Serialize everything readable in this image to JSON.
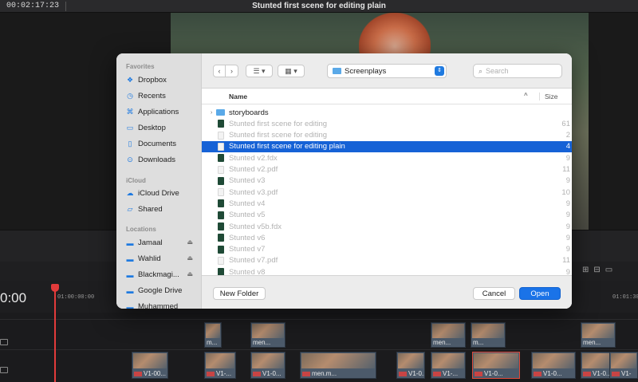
{
  "editor": {
    "timecode": "00:02:17:23",
    "project_title": "Stunted first scene for editing plain",
    "playhead_timecode": "0:00",
    "ruler_left": "01:00:00:00",
    "ruler_right": "01:01:30"
  },
  "timeline_clips": {
    "v2": [
      "m...",
      "men...",
      "men...",
      "m...",
      "men..."
    ],
    "v1": [
      "V1-00...",
      "V1-...",
      "V1-0...",
      "men.m...",
      "V1-0...",
      "V1-...",
      "V1-0...",
      "V1-0...",
      "V1-0...",
      "V1-"
    ]
  },
  "dialog": {
    "sidebar": {
      "favorites_heading": "Favorites",
      "favorites": [
        {
          "label": "Dropbox",
          "icon": "dropbox-icon"
        },
        {
          "label": "Recents",
          "icon": "clock-icon"
        },
        {
          "label": "Applications",
          "icon": "applications-icon"
        },
        {
          "label": "Desktop",
          "icon": "desktop-icon"
        },
        {
          "label": "Documents",
          "icon": "document-icon"
        },
        {
          "label": "Downloads",
          "icon": "download-icon"
        }
      ],
      "icloud_heading": "iCloud",
      "icloud": [
        {
          "label": "iCloud Drive",
          "icon": "cloud-icon"
        },
        {
          "label": "Shared",
          "icon": "shared-folder-icon"
        }
      ],
      "locations_heading": "Locations",
      "locations": [
        {
          "label": "Jamaal",
          "icon": "drive-icon",
          "eject": true
        },
        {
          "label": "Wahlid",
          "icon": "drive-icon",
          "eject": true
        },
        {
          "label": "Blackmagi...",
          "icon": "drive-icon",
          "eject": true
        },
        {
          "label": "Google Drive",
          "icon": "drive-icon",
          "eject": false
        },
        {
          "label": "Muhammed",
          "icon": "drive-icon",
          "eject": false
        }
      ]
    },
    "toolbar": {
      "location": "Screenplays",
      "search_placeholder": "Search"
    },
    "columns": {
      "name": "Name",
      "size": "Size"
    },
    "files": [
      {
        "name": "storyboards",
        "kind": "dir",
        "state": "norm",
        "size": ""
      },
      {
        "name": "Stunted first scene for editing",
        "kind": "fdx",
        "state": "dim",
        "size": "61"
      },
      {
        "name": "Stunted first scene for editing",
        "kind": "doc",
        "state": "dim",
        "size": "2"
      },
      {
        "name": "Stunted first scene for editing plain",
        "kind": "doc",
        "state": "sel",
        "size": "4"
      },
      {
        "name": "Stunted v2.fdx",
        "kind": "fdx",
        "state": "dim",
        "size": "9"
      },
      {
        "name": "Stunted v2.pdf",
        "kind": "pdf",
        "state": "dim",
        "size": "11"
      },
      {
        "name": "Stunted v3",
        "kind": "fdx",
        "state": "dim",
        "size": "9"
      },
      {
        "name": "Stunted v3.pdf",
        "kind": "pdf",
        "state": "dim",
        "size": "10"
      },
      {
        "name": "Stunted v4",
        "kind": "fdx",
        "state": "dim",
        "size": "9"
      },
      {
        "name": "Stunted v5",
        "kind": "fdx",
        "state": "dim",
        "size": "9"
      },
      {
        "name": "Stunted v5b.fdx",
        "kind": "fdx",
        "state": "dim",
        "size": "9"
      },
      {
        "name": "Stunted v6",
        "kind": "fdx",
        "state": "dim",
        "size": "9"
      },
      {
        "name": "Stunted v7",
        "kind": "fdx",
        "state": "dim",
        "size": "9"
      },
      {
        "name": "Stunted v7.pdf",
        "kind": "pdf",
        "state": "dim",
        "size": "11"
      },
      {
        "name": "Stunted v8",
        "kind": "fdx",
        "state": "dim",
        "size": "9"
      }
    ],
    "footer": {
      "new_folder": "New Folder",
      "cancel": "Cancel",
      "open": "Open"
    }
  }
}
